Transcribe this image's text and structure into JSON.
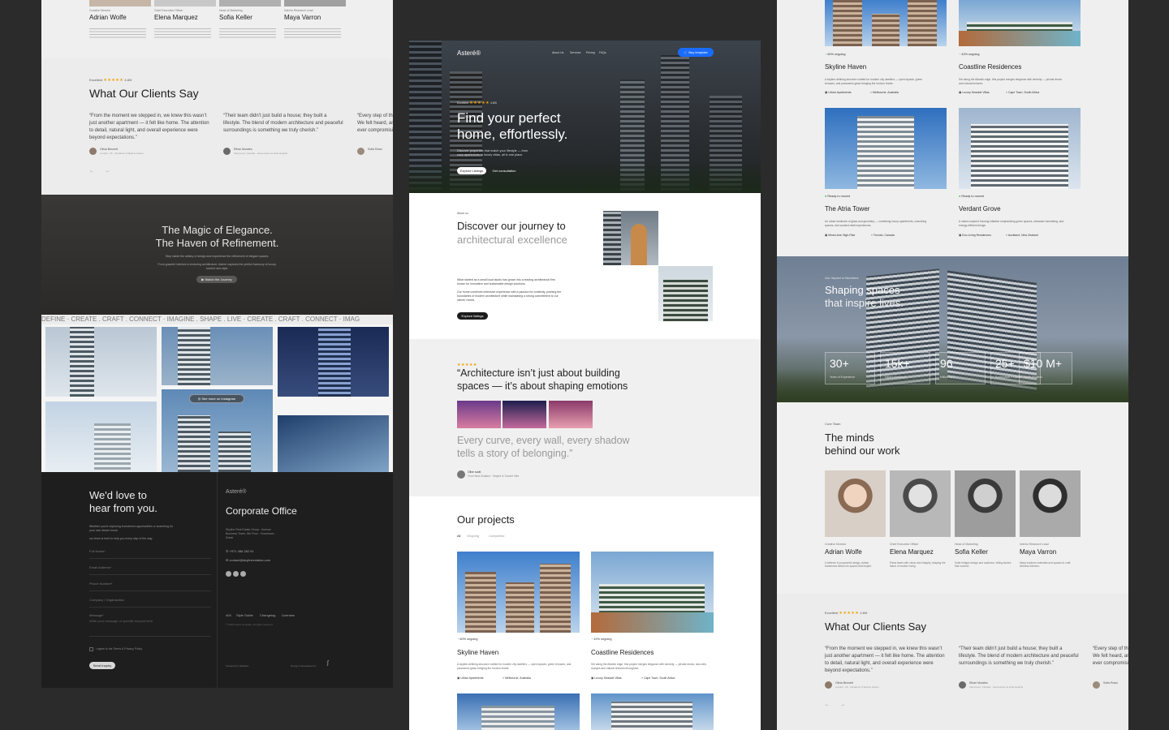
{
  "left_panel": {
    "team_top": [
      {
        "role": "Creative Director",
        "name": "Adrian Wolfe"
      },
      {
        "role": "Chief Executive Officer",
        "name": "Elena Marquez"
      },
      {
        "role": "Head of Marketing",
        "name": "Sofia Keller"
      },
      {
        "role": "Interior Research Lead",
        "name": "Maya Varron"
      }
    ],
    "rating_label": "Excellent",
    "rating_value": "4.8/5",
    "testimonials_title": "What Our Clients Say",
    "testimonials": [
      {
        "quote": "“From the moment we stepped in, we knew this wasn’t just another apartment — it felt like home. The attention to detail, natural light, and overall experience were beyond expectations.”",
        "author": "Olivia Bennett",
        "meta": "London, UK · Resident of Skyline Haven"
      },
      {
        "quote": "“Their team didn’t just build a house; they built a lifestyle. The blend of modern architecture and peaceful surroundings is something we truly cherish.”",
        "author": "Ethan Morales",
        "meta": "Vancouver, Canada · Homeowner at Atria Heights"
      },
      {
        "quote": "“Every step of the process was handled professionally. We felt heard, and they prioritized our needs without ever compromising...",
        "author": "Sofia Rossi",
        "meta": "Milan, Italy"
      }
    ],
    "elegance_title_1": "The Magic of Elegance.",
    "elegance_title_2": "The Haven of Refinement.",
    "elegance_text": "Step inside the artistry of design and experience the refinement of elegant spaces.",
    "elegance_text_2": "From graceful interiors to enduring architecture, Astere captures the perfect harmony of luxury, comfort and style.",
    "watch_button": "Watch the Journey",
    "marquee": "DEFINE · CREATE . CRAFT . CONNECT · IMAGINE . SHAPE . LIVE · CREATE . CRAFT . CONNECT · IMAG",
    "instagram_button": "See more on Instagram",
    "contact_title_1": "We'd love to",
    "contact_title_2": "hear from you.",
    "contact_text": "Whether you're exploring investment opportunities or searching for your own dream home.",
    "contact_text_2": "our team is here to help you every step of the way.",
    "fields": [
      "Full Name*",
      "Email Address*",
      "Phone Number*",
      "Company / Organization"
    ],
    "message_label": "Message*",
    "message_placeholder": "Write your message or specific request here",
    "agree_text": "I agree to the Terms & Privacy Policy",
    "send_button": "Send Inquiry",
    "brand": "Asteré®",
    "office_title": "Corporate Office",
    "office_address": "Skyline Real Estate Group · Avenue Business Tower, 8th Floor · Downtown, Dubai",
    "phone": "+971 456 282 91",
    "email": "contact@skylineestates.com",
    "footer_links": [
      "404",
      "Style Guide",
      "Changelog",
      "Licenses"
    ],
    "copyright": "© 2025 Asteré Template. All rights reserved.",
    "powered": "Powered by Webflow",
    "designed": "Design & Developed by"
  },
  "hero": {
    "brand": "Asteré®",
    "nav": [
      "About Us",
      "Services",
      "Pricing",
      "FAQs"
    ],
    "buy_button": "Buy template",
    "rating_label": "Excellent",
    "rating_value": "4.8/5",
    "title_1": "Find your perfect",
    "title_2": "home, effortlessly.",
    "subtitle": "Discover properties that match your lifestyle — from cozy apartments to luxury villas, all in one place.",
    "btn_primary": "Explore Listings",
    "btn_secondary": "Get consultation"
  },
  "about": {
    "eyebrow": "About us",
    "title_1": "Discover our journey to",
    "title_2": "architectural excellence",
    "p1": "What started as a small local studio has grown into a leading architectural firm known for innovative and sustainable design solutions.",
    "p2": "Our home combines extensive experience with a passion for creativity, pushing the boundaries of modern architecture while maintaining a strong commitment to our clients' needs.",
    "button": "Explore listings"
  },
  "quote": {
    "title_1": "“Architecture isn’t just about building",
    "title_2": "spaces — it’s about shaping emotions",
    "sub_1": "Every curve, every wall, every shadow",
    "sub_2": "tells a story of belonging.”",
    "author": "Olive scott",
    "meta": "From New Zealand · Stayed in Sunset Villa"
  },
  "projects": {
    "title": "Our projects",
    "filters": [
      "All",
      "Ongoing",
      "Completed"
    ],
    "items": [
      {
        "status": "60% ongoing",
        "name": "Skyline Haven",
        "desc": "A skyline-defining structure crafted for modern city dwellers — open layouts, green terraces, and panoramic glass bringing the horizon inside.",
        "type": "Urban Apartments",
        "location": "Melbourne, Australia"
      },
      {
        "status": "42% ongoing",
        "name": "Coastline Residences",
        "desc": "Set along the Atlantic edge, this project merges elegance with serenity — private decks, sea-view lounges and natural textures throughout.",
        "type": "Luxury Seaside Villas",
        "location": "Cape Town, South Africa"
      }
    ]
  },
  "right_panel": {
    "projects_top": [
      {
        "status": "60% ongoing",
        "name": "Skyline Haven",
        "desc": "A skyline-defining structure crafted for modern city dwellers — open layouts, green terraces, and panoramic glass bringing the horizon inside.",
        "type": "Urban Apartments",
        "location": "Melbourne, Australia"
      },
      {
        "status": "42% ongoing",
        "name": "Coastline Residences",
        "desc": "Set along the Atlantic edge, this project merges elegance with serenity — private decks and natural textures.",
        "type": "Luxury Seaside Villas",
        "location": "Cape Town, South Africa"
      }
    ],
    "projects_bottom": [
      {
        "status": "Ready to moved",
        "name": "The Atria Tower",
        "desc": "An urban landmark of glass and geometry — combining luxury apartments, coworking spaces, and curated retail experiences.",
        "type": "Mixed-Use High-Rise",
        "location": "Toronto, Canada"
      },
      {
        "status": "Ready to moved",
        "name": "Verdant Grove",
        "desc": "A nature-inspired housing initiative emphasizing green spaces, rainwater harvesting, and energy-efficient design.",
        "type": "Eco-Living Residences",
        "location": "Auckland, New Zealand"
      }
    ],
    "impact_eyebrow": "Our Impact in Numbers",
    "impact_title_1": "Shaping spaces",
    "impact_title_2": "that inspire lives.",
    "stats": [
      {
        "value": "30+",
        "label": "Years of Experience"
      },
      {
        "value": "15k+",
        "label": "Happy Residents"
      },
      {
        "value": "96",
        "label": "Million sq. ft."
      },
      {
        "value": "25+",
        "label": "Sustainable Projects"
      },
      {
        "value": "$10 M+",
        "label": "Worth Projects"
      }
    ],
    "team_eyebrow": "Core Team",
    "team_title_1": "The minds",
    "team_title_2": "behind our work",
    "team": [
      {
        "role": "Creative Director",
        "name": "Adrian Wolfe",
        "bio": "A believer in purposeful design, Adrian transforms ideas into spaces that inspire."
      },
      {
        "role": "Chief Executive Officer",
        "name": "Elena Marquez",
        "bio": "Elena leads with vision and integrity, shaping the future of modern living."
      },
      {
        "role": "Head of Marketing",
        "name": "Sofia Keller",
        "bio": "Sofia bridges design and audience, telling stories that connect."
      },
      {
        "role": "Interior Research Lead",
        "name": "Maya Varron",
        "bio": "Maya explores materials and spaces to craft timeless interiors."
      }
    ],
    "rating_label": "Excellent",
    "rating_value": "4.8/5",
    "testimonials_title": "What Our Clients Say",
    "testimonials": [
      {
        "quote": "“From the moment we stepped in, we knew this wasn’t just another apartment — it felt like home. The attention to detail, natural light, and overall experience were beyond expectations.”",
        "author": "Olivia Bennett",
        "meta": "London, UK · Resident of Skyline Haven"
      },
      {
        "quote": "“Their team didn’t just build a house; they built a lifestyle. The blend of modern architecture and peaceful surroundings is something we truly cherish.”",
        "author": "Ethan Morales",
        "meta": "Vancouver, Canada · Homeowner at Atria Heights"
      },
      {
        "quote": "“Every step of the process was handled professionally. We felt heard, and they prioritized our needs without ever compromising...",
        "author": "Sofia Rossi",
        "meta": "Milan, Italy"
      }
    ]
  },
  "colors": {
    "accent": "#1a6cff",
    "star": "#f0a000",
    "green": "#2fa84f",
    "dark": "#1b1b1b"
  }
}
